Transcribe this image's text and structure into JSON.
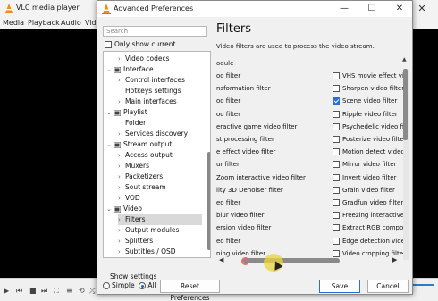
{
  "vlc": {
    "title": "VLC media player",
    "menu": [
      "Media",
      "Playback",
      "Audio",
      "Vid"
    ],
    "close": "✕"
  },
  "dialog": {
    "title": "Advanced Preferences",
    "minimize": "—",
    "maximize": "☐",
    "close": "✕"
  },
  "sidebar": {
    "search_placeholder": "Search",
    "only_current_label": "Only show current",
    "only_current_checked": false,
    "tree": [
      {
        "label": "Video codecs",
        "arrow": "›",
        "indent": 1,
        "icon": false
      },
      {
        "label": "Interface",
        "arrow": "⌄",
        "indent": 0,
        "icon": true
      },
      {
        "label": "Control interfaces",
        "arrow": "›",
        "indent": 1,
        "icon": false
      },
      {
        "label": "Hotkeys settings",
        "arrow": "",
        "indent": 1,
        "icon": false
      },
      {
        "label": "Main interfaces",
        "arrow": "›",
        "indent": 1,
        "icon": false
      },
      {
        "label": "Playlist",
        "arrow": "⌄",
        "indent": 0,
        "icon": true
      },
      {
        "label": "Folder",
        "arrow": "",
        "indent": 1,
        "icon": false
      },
      {
        "label": "Services discovery",
        "arrow": "›",
        "indent": 1,
        "icon": false
      },
      {
        "label": "Stream output",
        "arrow": "⌄",
        "indent": 0,
        "icon": true
      },
      {
        "label": "Access output",
        "arrow": "›",
        "indent": 1,
        "icon": false
      },
      {
        "label": "Muxers",
        "arrow": "›",
        "indent": 1,
        "icon": false
      },
      {
        "label": "Packetizers",
        "arrow": "›",
        "indent": 1,
        "icon": false
      },
      {
        "label": "Sout stream",
        "arrow": "›",
        "indent": 1,
        "icon": false
      },
      {
        "label": "VOD",
        "arrow": "›",
        "indent": 1,
        "icon": false
      },
      {
        "label": "Video",
        "arrow": "⌄",
        "indent": 0,
        "icon": true
      },
      {
        "label": "Filters",
        "arrow": "›",
        "indent": 1,
        "icon": false,
        "selected": true
      },
      {
        "label": "Output modules",
        "arrow": "›",
        "indent": 1,
        "icon": false
      },
      {
        "label": "Splitters",
        "arrow": "›",
        "indent": 1,
        "icon": false
      },
      {
        "label": "Subtitles / OSD",
        "arrow": "›",
        "indent": 1,
        "icon": false
      }
    ],
    "show_settings_label": "Show settings",
    "simple_label": "Simple",
    "all_label": "All",
    "selected_mode": "All"
  },
  "main": {
    "title": "Filters",
    "description": "Video filters are used to process the video stream.",
    "module_label": "odule",
    "left_filters": [
      "oo filter",
      "nsformation filter",
      "oo filter",
      "oo filter",
      "eractive game video filter",
      "st processing filter",
      "e effect video filter",
      "ur filter",
      "Zoom interactive video filter",
      "lity 3D Denoiser filter",
      "eo filter",
      "blur video filter",
      "ersion video filter",
      "eo filter",
      "ning video filter"
    ],
    "right_filters": [
      {
        "label": "VHS movie effect vi",
        "checked": false
      },
      {
        "label": "Sharpen video filter",
        "checked": false
      },
      {
        "label": "Scene video filter",
        "checked": true
      },
      {
        "label": "Ripple video filter",
        "checked": false
      },
      {
        "label": "Psychedelic video fi",
        "checked": false
      },
      {
        "label": "Posterize video filte",
        "checked": false
      },
      {
        "label": "Motion detect video",
        "checked": false
      },
      {
        "label": "Mirror video filter",
        "checked": false
      },
      {
        "label": "Invert video filter",
        "checked": false
      },
      {
        "label": "Grain video filter",
        "checked": false
      },
      {
        "label": "Gradfun video filter",
        "checked": false
      },
      {
        "label": "Freezing interactive",
        "checked": false
      },
      {
        "label": "Extract RGB compo",
        "checked": false
      },
      {
        "label": "Edge detection vide",
        "checked": false
      },
      {
        "label": "Video cropping filte",
        "checked": false
      }
    ]
  },
  "buttons": {
    "reset": "Reset Preferences",
    "save": "Save",
    "cancel": "Cancel"
  },
  "colors": {
    "accent": "#2a6ed6",
    "cursor_highlight": "#ecd43c"
  }
}
